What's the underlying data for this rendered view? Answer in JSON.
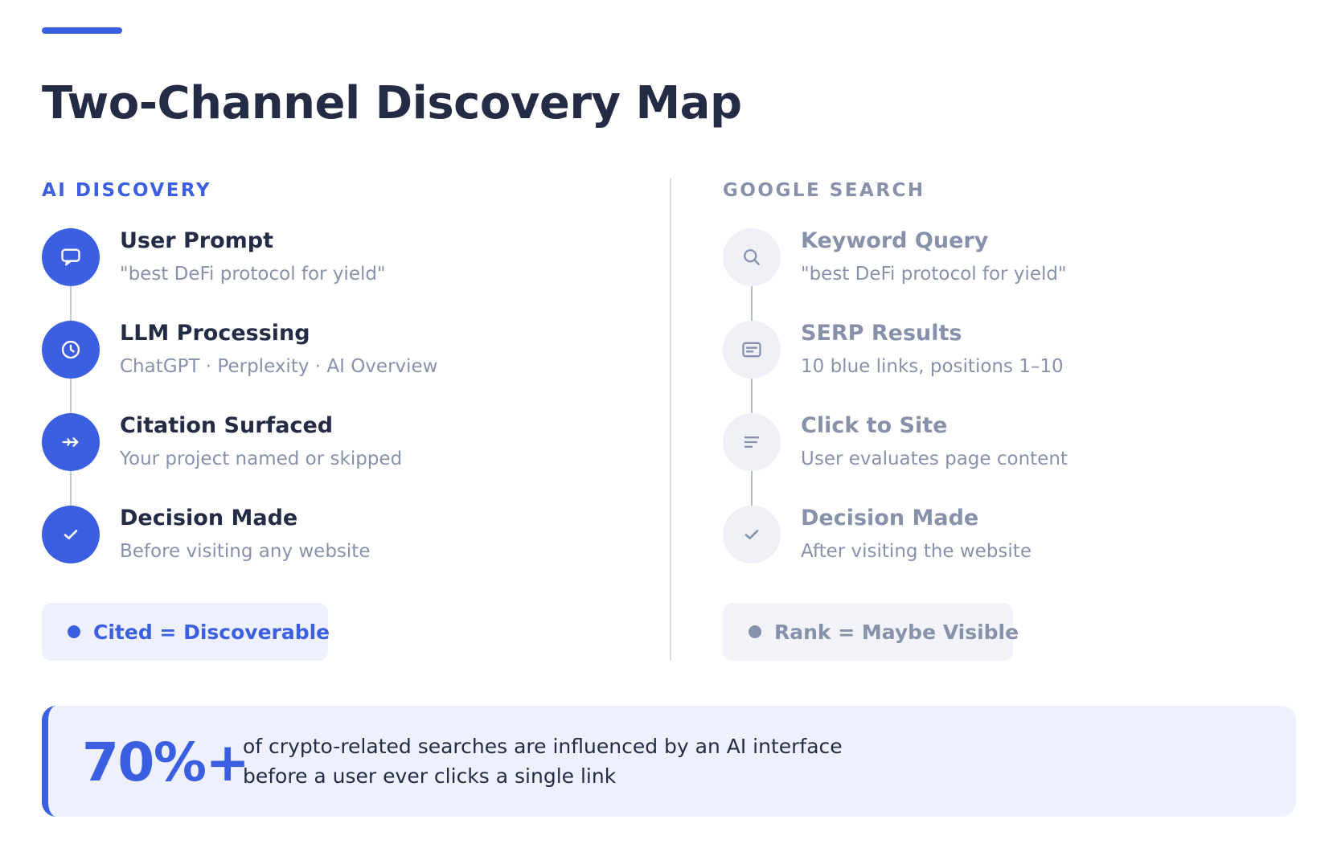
{
  "title": "Two-Channel Discovery Map",
  "colors": {
    "accent": "#3b5fe0",
    "dark_text": "#232b45",
    "muted_text": "#8792aa",
    "ai_badge_bg": "#eef1fd",
    "google_badge_bg": "#f1f3f8",
    "google_circle_bg": "#eef0f6"
  },
  "ai": {
    "heading": "AI DISCOVERY",
    "steps": [
      {
        "icon": "chat-bubble-icon",
        "title": "User Prompt",
        "subtitle": "\"best DeFi protocol for yield\""
      },
      {
        "icon": "clock-icon",
        "title": "LLM Processing",
        "subtitle": "ChatGPT · Perplexity · AI Overview"
      },
      {
        "icon": "arrow-right-icon",
        "title": "Citation Surfaced",
        "subtitle": "Your project named or skipped"
      },
      {
        "icon": "checkmark-icon",
        "title": "Decision Made",
        "subtitle": "Before visiting any website"
      }
    ],
    "badge": "Cited = Discoverable"
  },
  "google": {
    "heading": "GOOGLE SEARCH",
    "steps": [
      {
        "icon": "search-icon",
        "title": "Keyword Query",
        "subtitle": "\"best DeFi protocol for yield\""
      },
      {
        "icon": "results-list-icon",
        "title": "SERP Results",
        "subtitle": "10 blue links, positions 1–10"
      },
      {
        "icon": "text-lines-icon",
        "title": "Click to Site",
        "subtitle": "User evaluates page content"
      },
      {
        "icon": "checkmark-icon",
        "title": "Decision Made",
        "subtitle": "After visiting the website"
      }
    ],
    "badge": "Rank = Maybe Visible"
  },
  "stat": {
    "value": "70%+",
    "line1": "of crypto-related searches are influenced by an AI interface",
    "line2": "before a user ever clicks a single link"
  }
}
